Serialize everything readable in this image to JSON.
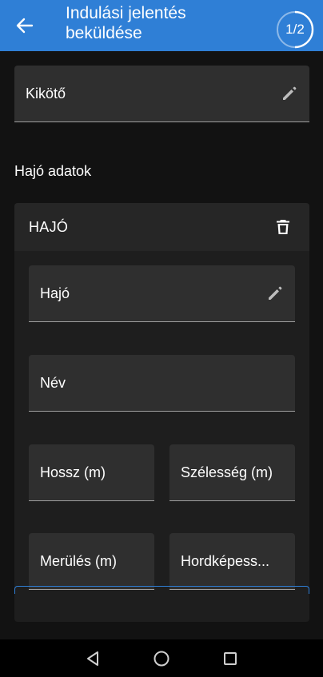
{
  "appbar": {
    "back_icon": "arrow-back-icon",
    "title": "Indulási jelentés beküldése",
    "step": "1/2",
    "step_progress": 0.5,
    "background": "#2f7fd6"
  },
  "form": {
    "port_field": {
      "label": "Kikötő",
      "icon": "edit-pencil-icon"
    },
    "section_title": "Hajó adatok",
    "ship_card": {
      "title": "HAJÓ",
      "delete_icon": "trash-icon",
      "ship_field": {
        "label": "Hajó",
        "icon": "edit-pencil-icon"
      },
      "name_field": {
        "label": "Név"
      },
      "length_field": {
        "label": "Hossz (m)"
      },
      "width_field": {
        "label": "Szélesség (m)"
      },
      "draft_field": {
        "label": "Merülés (m)"
      },
      "capacity_field": {
        "label": "Hordképess..."
      }
    }
  },
  "navbar": {
    "back_icon": "nav-back-triangle-icon",
    "home_icon": "nav-home-circle-icon",
    "recents_icon": "nav-recents-square-icon"
  },
  "colors": {
    "accent": "#2f7fd6",
    "background": "#121212",
    "card": "#1e1e1e",
    "field": "#2f2f2f"
  }
}
